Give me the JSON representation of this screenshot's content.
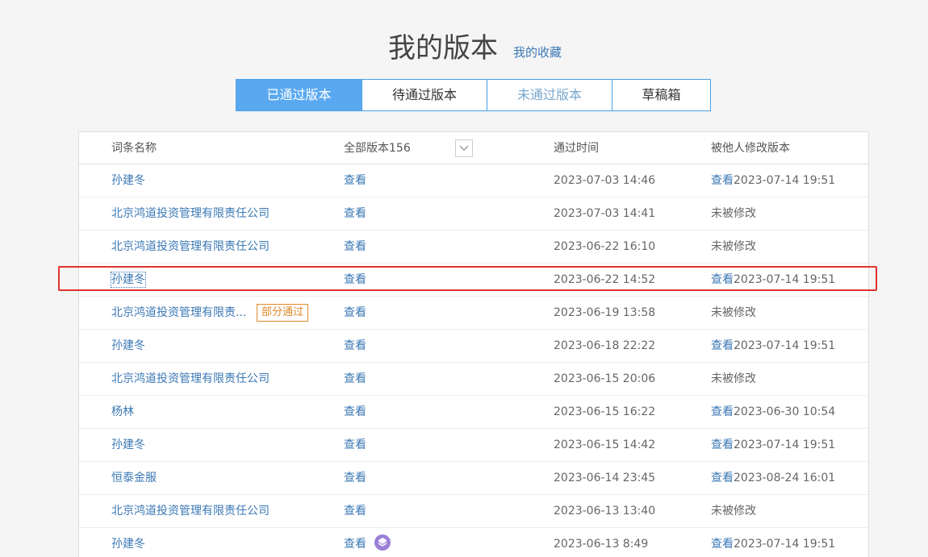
{
  "header": {
    "title": "我的版本",
    "favorites_link": "我的收藏"
  },
  "tabs": [
    {
      "label": "已通过版本",
      "state": "active"
    },
    {
      "label": "待通过版本",
      "state": "normal"
    },
    {
      "label": "未通过版本",
      "state": "muted"
    },
    {
      "label": "草稿箱",
      "state": "normal"
    }
  ],
  "table": {
    "columns": {
      "name": "词条名称",
      "versions": "全部版本156",
      "time": "通过时间",
      "modified": "被他人修改版本"
    },
    "rows": [
      {
        "name": "孙建冬",
        "view": "查看",
        "time": "2023-07-03 14:46",
        "mod_view": "查看",
        "mod_text": "2023-07-14 19:51"
      },
      {
        "name": "北京鸿道投资管理有限责任公司",
        "view": "查看",
        "time": "2023-07-03 14:41",
        "mod_view": "",
        "mod_text": "未被修改"
      },
      {
        "name": "北京鸿道投资管理有限责任公司",
        "view": "查看",
        "time": "2023-06-22 16:10",
        "mod_view": "",
        "mod_text": "未被修改"
      },
      {
        "name": "孙建冬",
        "view": "查看",
        "time": "2023-06-22 14:52",
        "mod_view": "查看",
        "mod_text": "2023-07-14 19:51"
      },
      {
        "name": "北京鸿道投资管理有限责...",
        "badge": "部分通过",
        "view": "查看",
        "time": "2023-06-19 13:58",
        "mod_view": "",
        "mod_text": "未被修改"
      },
      {
        "name": "孙建冬",
        "view": "查看",
        "time": "2023-06-18 22:22",
        "mod_view": "查看",
        "mod_text": "2023-07-14 19:51"
      },
      {
        "name": "北京鸿道投资管理有限责任公司",
        "view": "查看",
        "time": "2023-06-15 20:06",
        "mod_view": "",
        "mod_text": "未被修改"
      },
      {
        "name": "杨林",
        "view": "查看",
        "time": "2023-06-15 16:22",
        "mod_view": "查看",
        "mod_text": "2023-06-30 10:54"
      },
      {
        "name": "孙建冬",
        "view": "查看",
        "time": "2023-06-15 14:42",
        "mod_view": "查看",
        "mod_text": "2023-07-14 19:51"
      },
      {
        "name": "恒泰金服",
        "view": "查看",
        "time": "2023-06-14 23:45",
        "mod_view": "查看",
        "mod_text": "2023-08-24 16:01"
      },
      {
        "name": "北京鸿道投资管理有限责任公司",
        "view": "查看",
        "time": "2023-06-13 13:40",
        "mod_view": "",
        "mod_text": "未被修改"
      },
      {
        "name": "孙建冬",
        "view": "查看",
        "time": "2023-06-13 8:49",
        "mod_view": "查看",
        "mod_text": "2023-07-14 19:51",
        "layer_icon": "layers-icon"
      }
    ]
  },
  "colors": {
    "accent": "#5aa9f0",
    "link": "#3b78b5",
    "badge": "#e08a2a",
    "highlight": "#e0332c",
    "layer_icon": "#9b7fd9"
  }
}
